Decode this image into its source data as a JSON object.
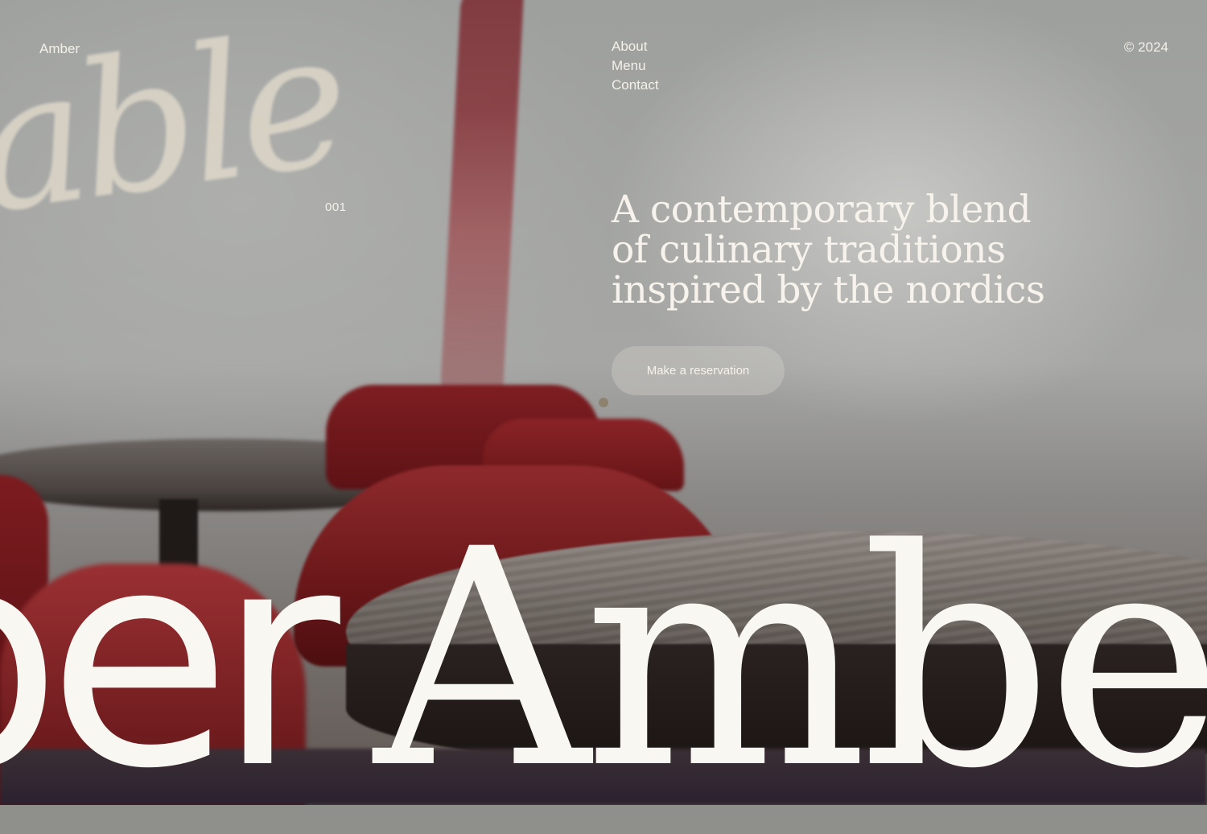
{
  "brand": {
    "name": "Amber"
  },
  "nav": {
    "items": [
      {
        "label": "About"
      },
      {
        "label": "Menu"
      },
      {
        "label": "Contact"
      }
    ]
  },
  "copyright": "© 2024",
  "hero": {
    "index": "001",
    "headline": "A contemporary blend of culinary traditions inspired by the nordics",
    "cta_label": "Make a reservation",
    "wordmark": "Amber"
  },
  "colors": {
    "text": "#f5f1e9",
    "button_bg": "#cdcac6",
    "dot": "#8c826e",
    "accent_red": "#7e1e22"
  }
}
